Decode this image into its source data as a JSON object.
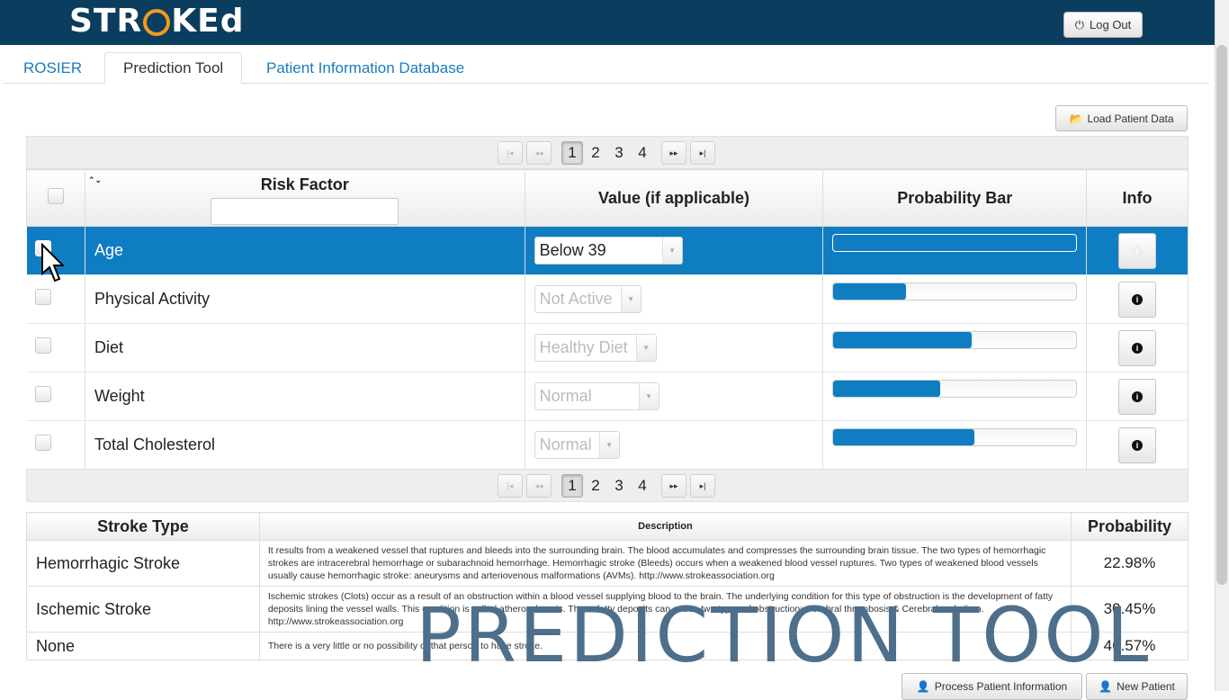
{
  "app": {
    "logo_text": "STR",
    "logo_o": "",
    "logo_tail": "KEd",
    "logout_label": "Log Out"
  },
  "tabs": [
    {
      "label": "ROSIER"
    },
    {
      "label": "Prediction Tool"
    },
    {
      "label": "Patient Information Database"
    }
  ],
  "toolbar": {
    "load_label": "Load Patient Data"
  },
  "pager": {
    "pages": [
      "1",
      "2",
      "3",
      "4"
    ],
    "current": "1"
  },
  "risk_table": {
    "headers": {
      "risk_factor": "Risk Factor",
      "value": "Value (if applicable)",
      "probability_bar": "Probability Bar",
      "info": "Info"
    },
    "filter_value": "",
    "rows": [
      {
        "factor": "Age",
        "value": "Below 39",
        "probability": 0.0,
        "selected": true
      },
      {
        "factor": "Physical Activity",
        "value": "Not Active",
        "probability": 0.3
      },
      {
        "factor": "Diet",
        "value": "Healthy Diet",
        "probability": 0.57
      },
      {
        "factor": "Weight",
        "value": "Normal",
        "probability": 0.44
      },
      {
        "factor": "Total Cholesterol",
        "value": "Normal",
        "probability": 0.58
      }
    ]
  },
  "stroke_table": {
    "headers": {
      "type": "Stroke Type",
      "description": "Description",
      "probability": "Probability"
    },
    "rows": [
      {
        "type": "Hemorrhagic Stroke",
        "description": "It results from a weakened vessel that ruptures and bleeds into the surrounding brain. The blood accumulates and compresses the surrounding brain tissue. The two types of hemorrhagic strokes are intracerebral hemorrhage or subarachnoid hemorrhage. Hemorrhagic stroke (Bleeds) occurs when a weakened blood vessel ruptures. Two types of weakened blood vessels usually cause hemorrhagic stroke: aneurysms and arteriovenous malformations (AVMs). http://www.strokeassociation.org",
        "probability": "22.98%"
      },
      {
        "type": "Ischemic Stroke",
        "description": "Ischemic strokes (Clots) occur as a result of an obstruction within a blood vessel supplying blood to the brain. The underlying condition for this type of obstruction is the development of fatty deposits lining the vessel walls. This condition is called atherosclerosis. These fatty deposits can cause two types of obstruction: Cerebral thrombosis & Cerebral embolism. http://www.strokeassociation.org",
        "probability": "30.45%"
      },
      {
        "type": "None",
        "description": "There is a very little or no possibility of that person to have stroke.",
        "probability": "46.57%"
      }
    ]
  },
  "footer": {
    "process_label": "Process Patient Information",
    "new_label": "New Patient"
  },
  "overlay": {
    "watermark": "PREDICTION TOOL"
  }
}
